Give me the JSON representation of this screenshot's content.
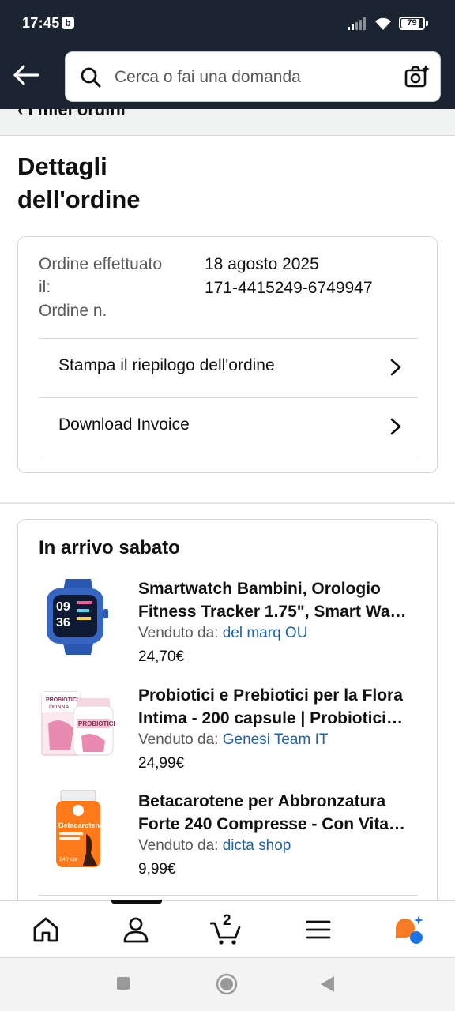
{
  "status_bar": {
    "time": "17:45",
    "app_badge": "b",
    "battery": "79"
  },
  "header": {
    "search_placeholder": "Cerca o fai una domanda",
    "icons": [
      "back-arrow-icon",
      "search-icon",
      "camera-icon"
    ]
  },
  "breadcrumb": {
    "label": "I miei ordini"
  },
  "page": {
    "title_line1": "Dettagli",
    "title_line2": "dell'ordine"
  },
  "order": {
    "placed_label_1": "Ordine effettuato",
    "placed_label_2": "il:",
    "number_label": "Ordine n.",
    "placed_date": "18 agosto 2025",
    "number": "171-4415249-6749947",
    "actions": [
      {
        "label": "Stampa il riepilogo dell'ordine"
      },
      {
        "label": "Download Invoice"
      }
    ]
  },
  "shipment": {
    "heading": "In arrivo sabato",
    "sold_by_label": "Venduto da:",
    "items": [
      {
        "title_line1": "Smartwatch Bambini, Orologio",
        "title_line2": "Fitness Tracker 1.75\", Smart Wa…",
        "seller": "del marq OU",
        "price": "24,70€"
      },
      {
        "title_line1": "Probiotici e Prebiotici per la Flora",
        "title_line2": "Intima - 200 capsule | Probiotici…",
        "seller": "Genesi Team IT",
        "price": "24,99€"
      },
      {
        "title_line1": "Betacarotene per Abbronzatura",
        "title_line2": "Forte 240 Compresse - Con Vita…",
        "seller": "dicta shop",
        "price": "9,99€"
      }
    ]
  },
  "bottom_nav": {
    "cart_count": "2",
    "items": [
      "home-icon",
      "account-icon",
      "cart-icon",
      "menu-icon",
      "rufus-assistant-icon"
    ]
  },
  "colors": {
    "header_bg": "#1b2431",
    "link": "#2162a1",
    "text": "#0f1111",
    "secondary_text": "#565959",
    "assistant_orange": "#f77a24",
    "assistant_blue": "#1a73e8"
  }
}
